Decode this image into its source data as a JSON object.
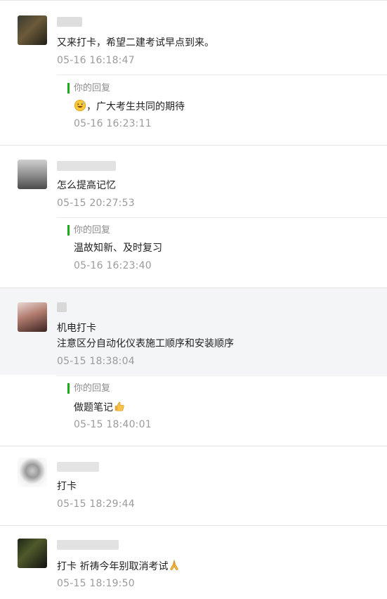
{
  "comments": [
    {
      "nickname": "",
      "lines": [
        "又来打卡，希望二建考试早点到来。"
      ],
      "time": "05-16 16:18:47",
      "reply": {
        "label": "你的回复",
        "text": "，广大考生共同的期待",
        "emoji": "grinning-sweat-emoji",
        "time": "05-16 16:23:11"
      }
    },
    {
      "nickname": "",
      "lines": [
        "怎么提高记忆"
      ],
      "time": "05-15 20:27:53",
      "reply": {
        "label": "你的回复",
        "text": "温故知新、及时复习",
        "time": "05-16 16:23:40"
      }
    },
    {
      "nickname": "",
      "lines": [
        "机电打卡",
        "注意区分自动化仪表施工顺序和安装顺序"
      ],
      "time": "05-15 18:38:04",
      "reply": {
        "label": "你的回复",
        "text": "做题笔记",
        "emoji": "thumbs-up-emoji",
        "time": "05-15 18:40:01"
      }
    },
    {
      "nickname": "",
      "lines": [
        "打卡"
      ],
      "time": "05-15 18:29:44"
    },
    {
      "nickname": "",
      "lines": [
        "打卡 祈祷今年别取消考试"
      ],
      "line_emoji": "folded-hands-emoji",
      "time": "05-15 18:19:50"
    }
  ],
  "colors": {
    "accent_green": "#1aad19",
    "time_gray": "#9b9b9b",
    "shaded_bg": "#f4f5f7"
  }
}
